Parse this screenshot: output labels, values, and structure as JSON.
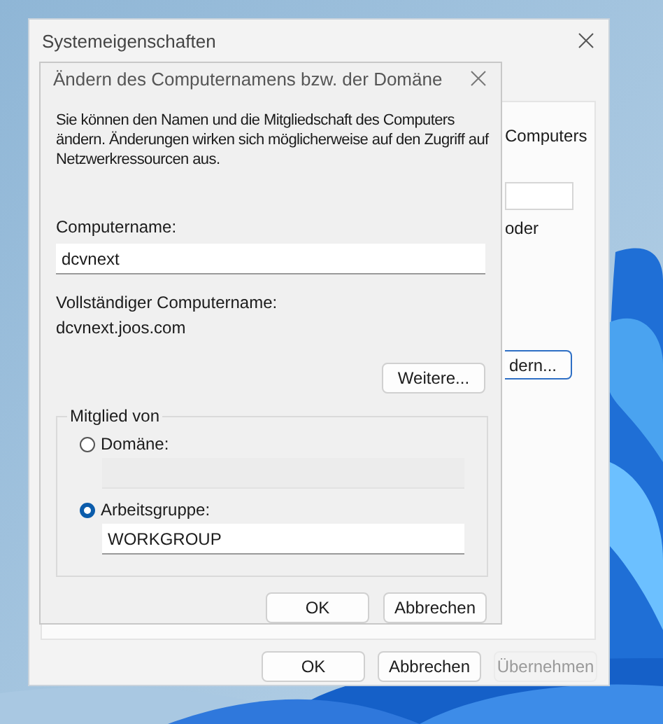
{
  "outer_window": {
    "title": "Systemeigenschaften",
    "panel_texts": [
      "Computers",
      "oder"
    ],
    "panel_button": "dern...",
    "buttons": [
      {
        "label": "OK",
        "disabled": false
      },
      {
        "label": "Abbrechen",
        "disabled": false
      },
      {
        "label": "Übernehmen",
        "disabled": true
      }
    ]
  },
  "dialog": {
    "title": "Ändern des Computernamens bzw. der Domäne",
    "description": "Sie können den Namen und die Mitgliedschaft des Computers ändern. Änderungen wirken sich möglicherweise auf den Zugriff auf Netzwerkressourcen aus.",
    "computer_name": {
      "label": "Computername:",
      "value": "dcvnext"
    },
    "full_name": {
      "label": "Vollständiger Computername:",
      "value": "dcvnext.joos.com"
    },
    "more_button": "Weitere...",
    "member_of": {
      "title": "Mitglied von",
      "options": [
        {
          "label": "Domäne:",
          "selected": false
        },
        {
          "label": "Arbeitsgruppe:",
          "selected": true,
          "value": "WORKGROUP"
        }
      ]
    },
    "buttons": [
      "OK",
      "Abbrechen"
    ]
  }
}
